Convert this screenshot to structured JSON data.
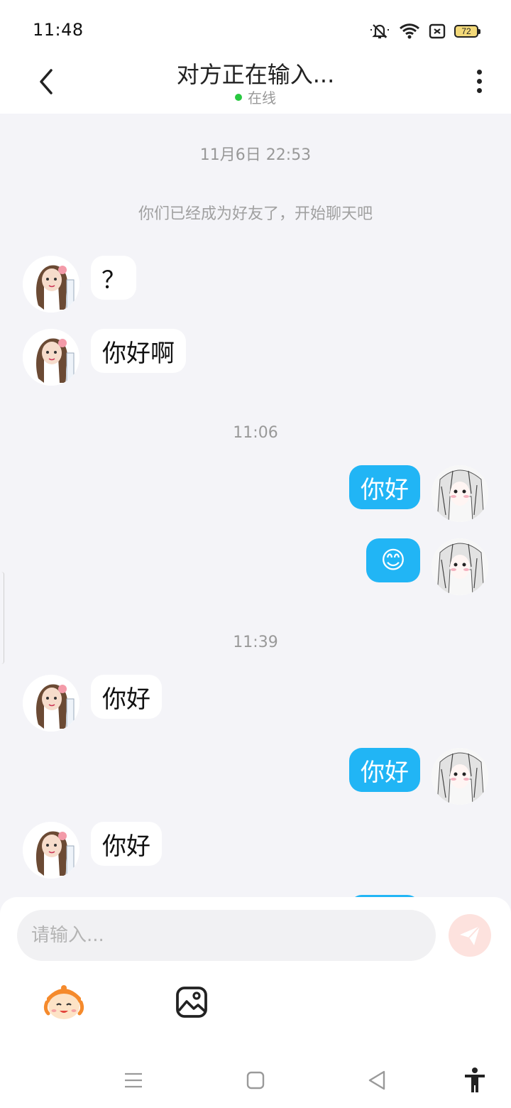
{
  "status_bar": {
    "time": "11:48",
    "battery": "72",
    "icons": [
      "mute-bell-icon",
      "wifi-icon",
      "sim-card-icon",
      "battery-icon"
    ]
  },
  "header": {
    "title": "对方正在输入...",
    "status": "在线",
    "status_color": "#28c840"
  },
  "messages": [
    {
      "type": "timestamp",
      "text": "11月6日 22:53"
    },
    {
      "type": "system",
      "text": "你们已经成为好友了，开始聊天吧"
    },
    {
      "type": "in",
      "text": "？"
    },
    {
      "type": "in",
      "text": "你好啊"
    },
    {
      "type": "timestamp",
      "text": "11:06"
    },
    {
      "type": "out",
      "text": "你好"
    },
    {
      "type": "out",
      "text": "😊"
    },
    {
      "type": "timestamp",
      "text": "11:39"
    },
    {
      "type": "in",
      "text": "你好"
    },
    {
      "type": "out",
      "text": "你好"
    },
    {
      "type": "in",
      "text": "你好"
    }
  ],
  "input": {
    "placeholder": "请输入..."
  },
  "colors": {
    "outgoing_bubble": "#21b5f5",
    "incoming_bubble": "#ffffff",
    "chat_background": "#f4f4f8",
    "send_button": "#fde2de"
  },
  "toolbar": {
    "icons": [
      "mascot-emoji-icon",
      "image-icon"
    ]
  },
  "nav_bar": {
    "icons": [
      "menu-icon",
      "home-square-icon",
      "back-triangle-icon",
      "accessibility-icon"
    ]
  }
}
